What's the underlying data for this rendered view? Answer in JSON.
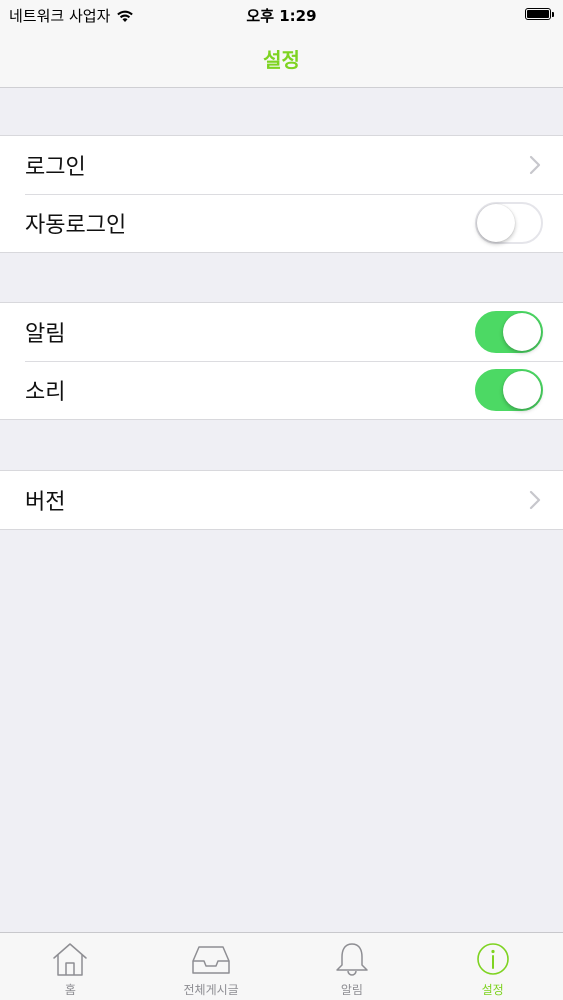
{
  "status_bar": {
    "carrier": "네트워크 사업자",
    "time": "오후 1:29"
  },
  "nav": {
    "title": "설정"
  },
  "settings": {
    "login": {
      "label": "로그인"
    },
    "auto_login": {
      "label": "자동로그인",
      "on": false
    },
    "notifications": {
      "label": "알림",
      "on": true
    },
    "sound": {
      "label": "소리",
      "on": true
    },
    "version": {
      "label": "버전"
    }
  },
  "tabs": [
    {
      "label": "홈",
      "icon": "home-icon",
      "active": false
    },
    {
      "label": "전체게시글",
      "icon": "inbox-icon",
      "active": false
    },
    {
      "label": "알림",
      "icon": "bell-icon",
      "active": false
    },
    {
      "label": "설정",
      "icon": "info-icon",
      "active": true
    }
  ],
  "colors": {
    "accent": "#7ed321",
    "toggle_on": "#4cd964",
    "background": "#efeff4"
  }
}
